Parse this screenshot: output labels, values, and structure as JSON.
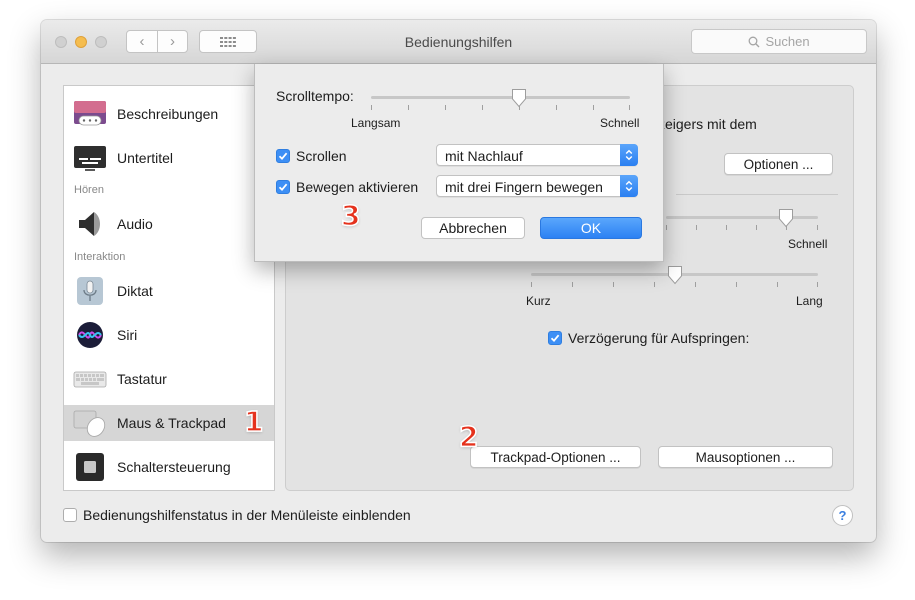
{
  "window": {
    "title": "Bedienungshilfen"
  },
  "titlebar": {
    "search_placeholder": "Suchen"
  },
  "sidebar": {
    "items": [
      {
        "label": "Beschreibungen",
        "icon": "descriptions-icon"
      },
      {
        "label": "Untertitel",
        "icon": "subtitles-icon"
      },
      {
        "label": "Audio",
        "icon": "speaker-icon"
      },
      {
        "label": "Diktat",
        "icon": "microphone-icon"
      },
      {
        "label": "Siri",
        "icon": "siri-icon"
      },
      {
        "label": "Tastatur",
        "icon": "keyboard-icon"
      },
      {
        "label": "Maus & Trackpad",
        "icon": "mouse-trackpad-icon",
        "selected": true
      },
      {
        "label": "Schaltersteuerung",
        "icon": "switch-control-icon"
      }
    ],
    "sections": {
      "hearing": "Hören",
      "interaction": "Interaktion"
    }
  },
  "main": {
    "partial_text": "zeigers mit dem",
    "options_button": "Optionen ...",
    "speed_slider": {
      "max_label": "Schnell",
      "value_fraction": 0.79
    },
    "spring_loading": {
      "label": "Verzögerung für Aufspringen:",
      "checked": true,
      "min_label": "Kurz",
      "max_label": "Lang",
      "value_fraction": 0.5
    },
    "trackpad_options_button": "Trackpad-Optionen ...",
    "mouse_options_button": "Mausoptionen ..."
  },
  "sheet": {
    "scroll_speed_label": "Scrolltempo:",
    "scroll_slider": {
      "min_label": "Langsam",
      "max_label": "Schnell",
      "value_fraction": 0.57
    },
    "scrolling": {
      "label": "Scrollen",
      "checked": true,
      "selected": "mit Nachlauf"
    },
    "dragging": {
      "label": "Bewegen aktivieren",
      "checked": true,
      "selected": "mit drei Fingern bewegen"
    },
    "cancel_button": "Abbrechen",
    "ok_button": "OK"
  },
  "footer": {
    "checkbox_label": "Bedienungshilfenstatus in der Menüleiste einblenden",
    "checked": false,
    "help_label": "?"
  },
  "annotations": {
    "step1": "1",
    "step2": "2",
    "step3": "3"
  },
  "colors": {
    "accent": "#3d8ff5",
    "annotation": "#e5321d",
    "minimize": "#f5bd4f"
  }
}
